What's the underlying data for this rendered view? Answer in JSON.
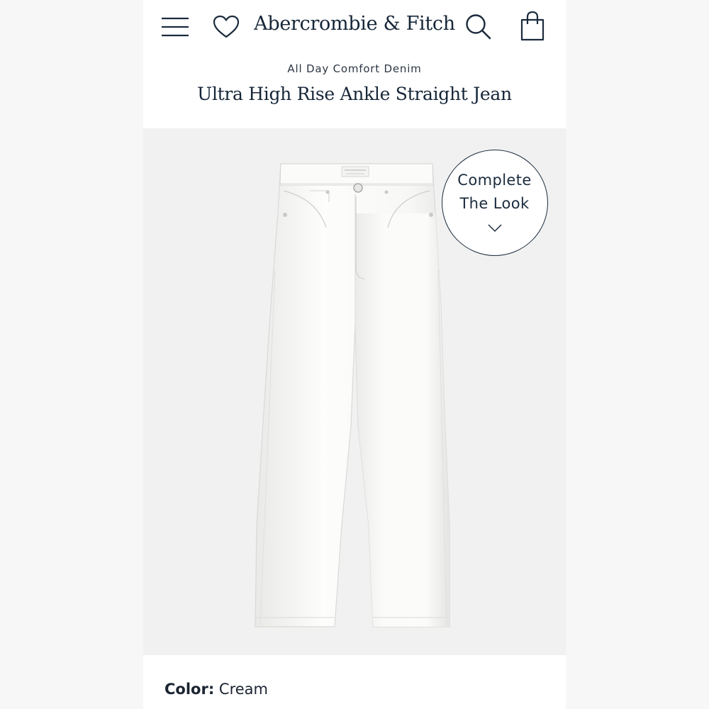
{
  "header": {
    "brand": "Abercrombie & Fitch",
    "icons": {
      "menu": "hamburger-menu-icon",
      "wishlist": "heart-icon",
      "search": "search-icon",
      "bag": "shopping-bag-icon"
    }
  },
  "product": {
    "collection": "All Day Comfort Denim",
    "title": "Ultra High Rise Ankle Straight Jean",
    "image_alt": "white jeans",
    "complete_the_look": {
      "line1": "Complete",
      "line2": "The Look"
    },
    "color_label": "Color:",
    "color_value": "Cream"
  },
  "colors": {
    "navy_text": "#162638",
    "image_bg": "#f1f1f1",
    "page_bg": "#f7f7f7"
  }
}
